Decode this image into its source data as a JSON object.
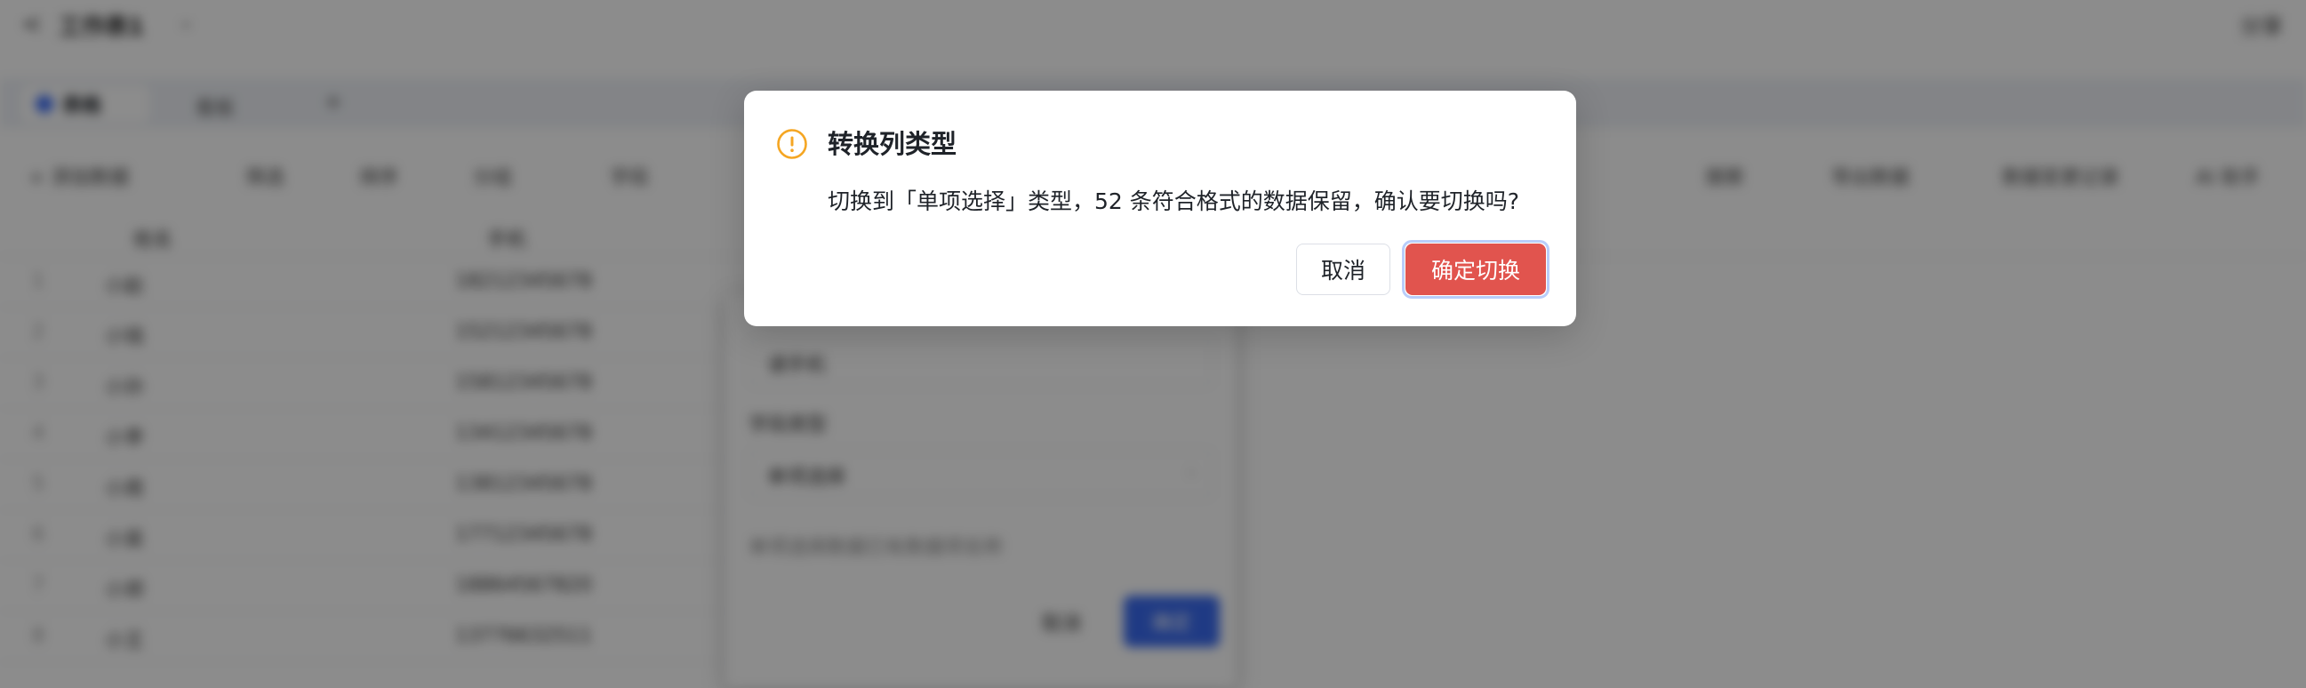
{
  "background": {
    "topbar": {
      "back_glyph": "<",
      "title": "工作表1",
      "chevron_glyph": "⌄",
      "share_label": "分享"
    },
    "tabs": [
      {
        "label": "表格"
      },
      {
        "label": "看板"
      }
    ],
    "tab_add_glyph": "+",
    "toolbar": {
      "add_data": "+ 添加数据",
      "filter": "筛选",
      "sort": "排序",
      "group": "分组",
      "fields": "字段",
      "search": "搜索",
      "export": "导出数据",
      "records": "数据变更记录",
      "history": "AI 助手"
    },
    "table": {
      "headers": [
        "姓名",
        "手机"
      ],
      "rows": [
        {
          "idx": "1",
          "name": "小赵",
          "phone": "18212345678"
        },
        {
          "idx": "2",
          "name": "小钱",
          "phone": "15212345678"
        },
        {
          "idx": "3",
          "name": "小孙",
          "phone": "15812345678"
        },
        {
          "idx": "4",
          "name": "小李",
          "phone": "13412345678"
        },
        {
          "idx": "5",
          "name": "小周",
          "phone": "13812345678"
        },
        {
          "idx": "6",
          "name": "小吴",
          "phone": "17712345678"
        },
        {
          "idx": "7",
          "name": "小郑",
          "phone": "18864567820"
        },
        {
          "idx": "8",
          "name": "小王",
          "phone": "13776632511"
        }
      ]
    },
    "side_panel": {
      "field_value": "请手机",
      "type_label": "字段类型",
      "type_value": "单项选择",
      "hint": "单项选择数据已有数据项名称",
      "cancel": "取消",
      "ok": "确定"
    }
  },
  "dialog": {
    "icon": "warning-circle-icon",
    "title": "转换列类型",
    "message": "切换到「单项选择」类型，52 条符合格式的数据保留，确认要切换吗?",
    "cancel_label": "取消",
    "confirm_label": "确定切换"
  },
  "colors": {
    "warning": "#f5a623",
    "danger": "#e1544e",
    "focus_ring": "#b9cdfa",
    "overlay": "rgba(0,0,0,0.45)"
  }
}
